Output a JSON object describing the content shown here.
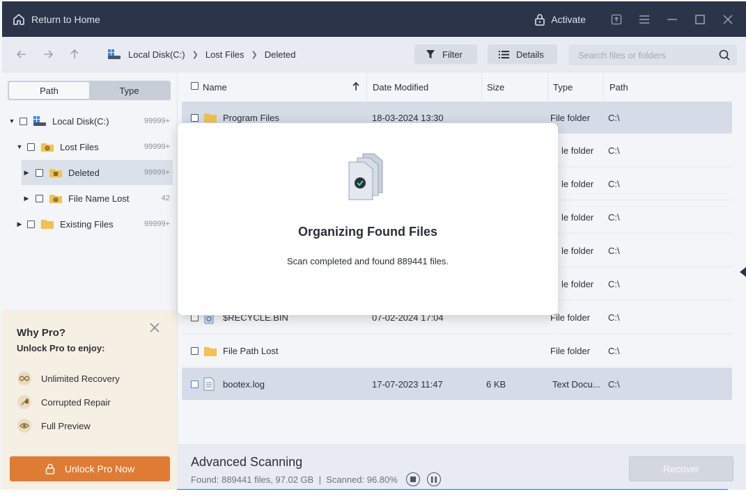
{
  "titlebar": {
    "home_label": "Return to Home",
    "activate_label": "Activate"
  },
  "toolbar": {
    "breadcrumb": [
      "Local Disk(C:)",
      "Lost Files",
      "Deleted"
    ],
    "filter_label": "Filter",
    "details_label": "Details",
    "search_placeholder": "Search files or folders"
  },
  "sidebar": {
    "tabs": [
      "Path",
      "Type"
    ],
    "active_tab": "Path",
    "tree": [
      {
        "label": "Local Disk(C:)",
        "count": "99999+"
      },
      {
        "label": "Lost Files",
        "count": "99999+"
      },
      {
        "label": "Deleted",
        "count": "99999+"
      },
      {
        "label": "File Name Lost",
        "count": "42"
      },
      {
        "label": "Existing Files",
        "count": "99999+"
      }
    ]
  },
  "pro": {
    "title": "Why Pro?",
    "subtitle": "Unlock Pro to enjoy:",
    "features": [
      "Unlimited Recovery",
      "Corrupted Repair",
      "Full Preview"
    ],
    "button_label": "Unlock Pro Now"
  },
  "list": {
    "columns": [
      "Name",
      "Date Modified",
      "Size",
      "Type",
      "Path"
    ],
    "rows": [
      {
        "name": "Program Files",
        "date": "18-03-2024 13:30",
        "size": "",
        "type": "File folder",
        "path": "C:\\"
      },
      {
        "name": "",
        "date": "",
        "size": "",
        "type": "File folder",
        "path": "C:\\"
      },
      {
        "name": "",
        "date": "",
        "size": "",
        "type": "File folder",
        "path": "C:\\"
      },
      {
        "name": "",
        "date": "",
        "size": "",
        "type": "File folder",
        "path": "C:\\"
      },
      {
        "name": "",
        "date": "",
        "size": "",
        "type": "File folder",
        "path": "C:\\"
      },
      {
        "name": "",
        "date": "",
        "size": "",
        "type": "File folder",
        "path": "C:\\"
      },
      {
        "name": "$RECYCLE.BIN",
        "date": "07-02-2024 17:04",
        "size": "",
        "type": "File folder",
        "path": "C:\\"
      },
      {
        "name": "File Path Lost",
        "date": "",
        "size": "",
        "type": "File folder",
        "path": "C:\\"
      },
      {
        "name": "bootex.log",
        "date": "17-07-2023 11:47",
        "size": "6 KB",
        "type": "Text Docu...",
        "path": "C:\\"
      }
    ],
    "partial_types": [
      "le folder",
      "le folder",
      "le folder",
      "le folder",
      "le folder"
    ]
  },
  "modal": {
    "title": "Organizing Found Files",
    "message": "Scan completed and found 889441 files."
  },
  "bottom": {
    "title": "Advanced Scanning",
    "stats": "Found: 889441 files, 97.02 GB  |  Scanned: 96.80%",
    "recover_label": "Recover",
    "progress_fraction": 0.968
  },
  "colors": {
    "titlebar": "#2c3449",
    "accent": "#2d6cdf",
    "pro_button": "#e07b34"
  }
}
